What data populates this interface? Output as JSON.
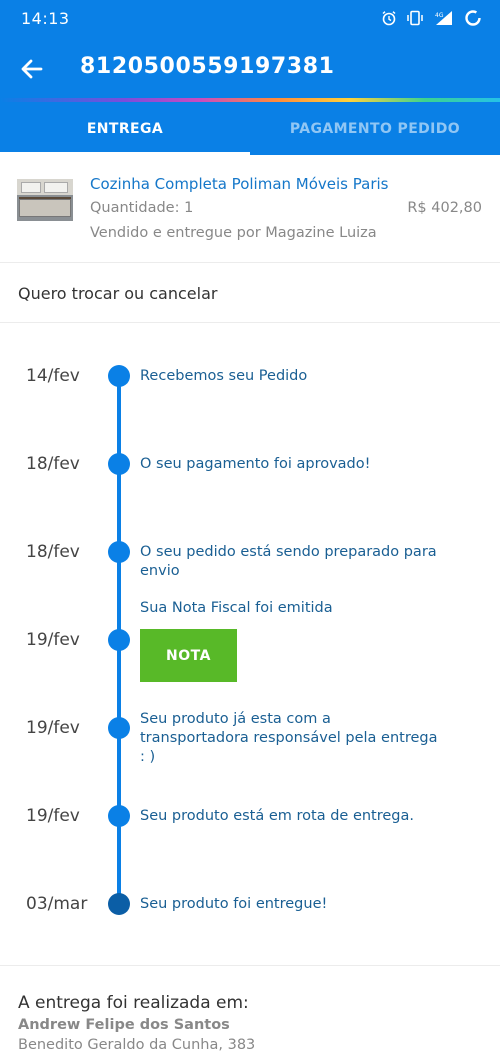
{
  "status_bar": {
    "time": "14:13",
    "icons": [
      "alarm-icon",
      "vibrate-icon",
      "signal-4g-icon",
      "loading-icon"
    ]
  },
  "app_bar": {
    "title": "8120500559197381",
    "back_icon": "arrow-left-icon"
  },
  "tabs": [
    {
      "label": "ENTREGA",
      "active": true
    },
    {
      "label": "PAGAMENTO PEDIDO",
      "active": false
    }
  ],
  "product": {
    "name": "Cozinha Completa Poliman Móveis Paris",
    "quantity": "Quantidade: 1",
    "price": "R$ 402,80",
    "seller": "Vendido e entregue por Magazine Luiza"
  },
  "exchange": {
    "label": "Quero trocar ou cancelar"
  },
  "timeline": [
    {
      "date": "14/fev",
      "text": "Recebemos seu Pedido"
    },
    {
      "date": "18/fev",
      "text": "O seu pagamento foi aprovado!"
    },
    {
      "date": "18/fev",
      "text": "O seu pedido está sendo preparado para envio"
    },
    {
      "date": "19/fev",
      "text": "Sua Nota Fiscal foi emitida",
      "button": "NOTA"
    },
    {
      "date": "19/fev",
      "text": "Seu produto já esta com a transportadora responsável pela entrega : )"
    },
    {
      "date": "19/fev",
      "text": "Seu produto está em rota de entrega."
    },
    {
      "date": "03/mar",
      "text": "Seu produto foi entregue!"
    }
  ],
  "delivery": {
    "label": "A entrega foi realizada em:",
    "recipient": "Andrew Felipe dos Santos",
    "address": "Benedito Geraldo da Cunha, 383"
  },
  "colors": {
    "primary": "#0a80e6",
    "link": "#1577c9",
    "success": "#58b928"
  }
}
